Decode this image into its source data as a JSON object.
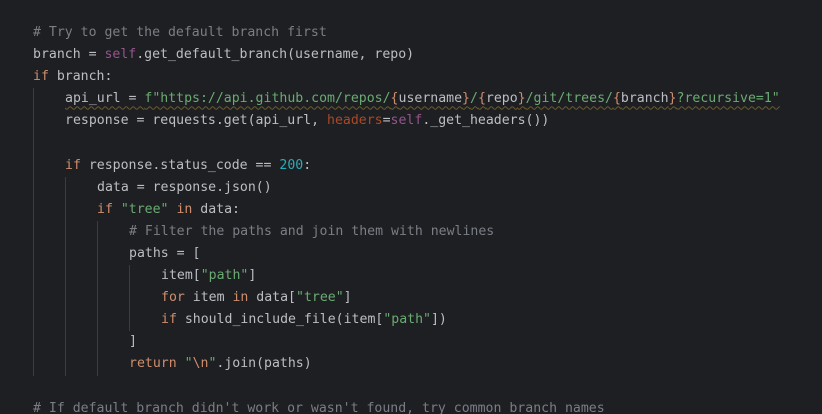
{
  "editor": {
    "lines": [
      {
        "indent": 0,
        "tokens": [
          {
            "t": "cmt",
            "v": "# Try to get the default branch first"
          }
        ]
      },
      {
        "indent": 0,
        "tokens": [
          {
            "t": "plain",
            "v": "branch = "
          },
          {
            "t": "self",
            "v": "self"
          },
          {
            "t": "plain",
            "v": ".get_default_branch(username, repo)"
          }
        ]
      },
      {
        "indent": 0,
        "tokens": [
          {
            "t": "kw",
            "v": "if"
          },
          {
            "t": "plain",
            "v": " branch:"
          }
        ]
      },
      {
        "indent": 1,
        "squiggle": true,
        "tokens": [
          {
            "t": "plain",
            "v": "api_url = "
          },
          {
            "t": "str",
            "v": "f\"https://api.github.com/repos/"
          },
          {
            "t": "kw",
            "v": "{"
          },
          {
            "t": "plain",
            "v": "username"
          },
          {
            "t": "kw",
            "v": "}"
          },
          {
            "t": "str",
            "v": "/"
          },
          {
            "t": "kw",
            "v": "{"
          },
          {
            "t": "plain",
            "v": "repo"
          },
          {
            "t": "kw",
            "v": "}"
          },
          {
            "t": "str",
            "v": "/git/trees/"
          },
          {
            "t": "kw",
            "v": "{"
          },
          {
            "t": "plain",
            "v": "branch"
          },
          {
            "t": "kw",
            "v": "}"
          },
          {
            "t": "str",
            "v": "?recursive=1\""
          }
        ]
      },
      {
        "indent": 1,
        "tokens": [
          {
            "t": "plain",
            "v": "response = requests.get(api_url, "
          },
          {
            "t": "kwarg",
            "v": "headers"
          },
          {
            "t": "plain",
            "v": "="
          },
          {
            "t": "self",
            "v": "self"
          },
          {
            "t": "plain",
            "v": "._get_headers())"
          }
        ]
      },
      {
        "indent": 1,
        "tokens": []
      },
      {
        "indent": 1,
        "tokens": [
          {
            "t": "kw",
            "v": "if"
          },
          {
            "t": "plain",
            "v": " response.status_code == "
          },
          {
            "t": "num",
            "v": "200"
          },
          {
            "t": "plain",
            "v": ":"
          }
        ]
      },
      {
        "indent": 2,
        "tokens": [
          {
            "t": "plain",
            "v": "data = response.json()"
          }
        ]
      },
      {
        "indent": 2,
        "tokens": [
          {
            "t": "kw",
            "v": "if"
          },
          {
            "t": "plain",
            "v": " "
          },
          {
            "t": "str",
            "v": "\"tree\""
          },
          {
            "t": "plain",
            "v": " "
          },
          {
            "t": "kw",
            "v": "in"
          },
          {
            "t": "plain",
            "v": " data:"
          }
        ]
      },
      {
        "indent": 3,
        "tokens": [
          {
            "t": "cmt",
            "v": "# Filter the paths and join them with newlines"
          }
        ]
      },
      {
        "indent": 3,
        "tokens": [
          {
            "t": "plain",
            "v": "paths = ["
          }
        ]
      },
      {
        "indent": 4,
        "tokens": [
          {
            "t": "plain",
            "v": "item["
          },
          {
            "t": "str",
            "v": "\"path\""
          },
          {
            "t": "plain",
            "v": "]"
          }
        ]
      },
      {
        "indent": 4,
        "tokens": [
          {
            "t": "kw",
            "v": "for"
          },
          {
            "t": "plain",
            "v": " item "
          },
          {
            "t": "kw",
            "v": "in"
          },
          {
            "t": "plain",
            "v": " data["
          },
          {
            "t": "str",
            "v": "\"tree\""
          },
          {
            "t": "plain",
            "v": "]"
          }
        ]
      },
      {
        "indent": 4,
        "tokens": [
          {
            "t": "kw",
            "v": "if"
          },
          {
            "t": "plain",
            "v": " should_include_file(item["
          },
          {
            "t": "str",
            "v": "\"path\""
          },
          {
            "t": "plain",
            "v": "])"
          }
        ]
      },
      {
        "indent": 3,
        "tokens": [
          {
            "t": "plain",
            "v": "]"
          }
        ]
      },
      {
        "indent": 3,
        "tokens": [
          {
            "t": "kw",
            "v": "return"
          },
          {
            "t": "plain",
            "v": " "
          },
          {
            "t": "str",
            "v": "\""
          },
          {
            "t": "esc",
            "v": "\\n"
          },
          {
            "t": "str",
            "v": "\""
          },
          {
            "t": "plain",
            "v": ".join(paths)"
          }
        ]
      },
      {
        "indent": 0,
        "tokens": []
      },
      {
        "indent": 0,
        "tokens": [
          {
            "t": "cmt",
            "v": "# If default branch didn't work or wasn't found, try common branch names"
          }
        ]
      }
    ]
  },
  "colors": {
    "background": "#1e1f22",
    "text": "#bcbec4",
    "keyword": "#cf8e6d",
    "self": "#94558d",
    "string": "#6aab73",
    "number": "#2aacb8",
    "comment": "#7a7e85",
    "kwarg": "#aa4926",
    "indent_guide": "#393b40"
  }
}
